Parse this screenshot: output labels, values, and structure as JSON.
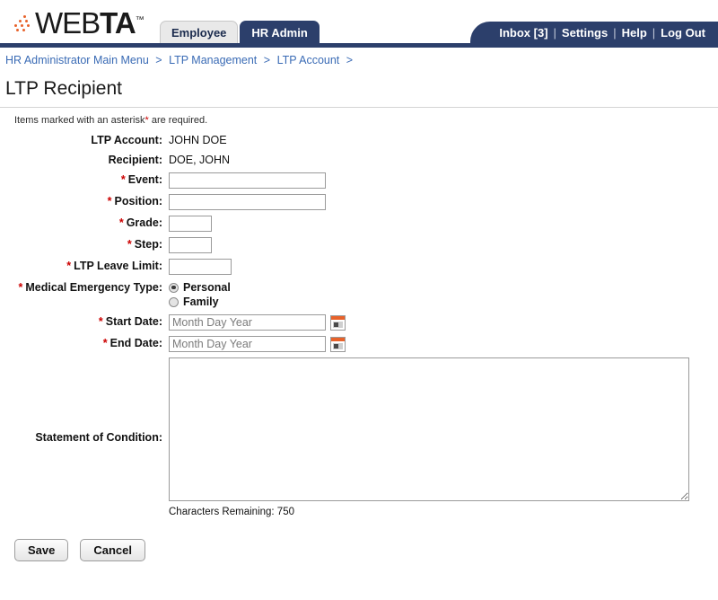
{
  "app": {
    "logo_text_light": "WEB",
    "logo_text_bold": "TA",
    "logo_tm": "™"
  },
  "tabs": [
    {
      "label": "Employee",
      "active": false
    },
    {
      "label": "HR Admin",
      "active": true
    }
  ],
  "navbar": {
    "items": [
      "Inbox [3]",
      "Settings",
      "Help",
      "Log Out"
    ],
    "separator": "|"
  },
  "breadcrumb": {
    "items": [
      "HR Administrator Main Menu",
      "LTP Management",
      "LTP Account"
    ],
    "separator": ">",
    "trailing": ">"
  },
  "page": {
    "title": "LTP Recipient",
    "required_note_before": "Items marked with an asterisk",
    "required_note_asterisk": "*",
    "required_note_after": " are required."
  },
  "form": {
    "asterisk": "*",
    "rows": [
      {
        "label": "LTP Account:",
        "required": false,
        "type": "static",
        "value": "JOHN DOE"
      },
      {
        "label": "Recipient:",
        "required": false,
        "type": "static",
        "value": "DOE, JOHN"
      },
      {
        "label": "Event:",
        "required": true,
        "type": "text",
        "value": "",
        "placeholder": ""
      },
      {
        "label": "Position:",
        "required": true,
        "type": "text",
        "value": "",
        "placeholder": ""
      },
      {
        "label": "Grade:",
        "required": true,
        "type": "text",
        "value": "",
        "placeholder": ""
      },
      {
        "label": "Step:",
        "required": true,
        "type": "text",
        "value": "",
        "placeholder": ""
      },
      {
        "label": "LTP Leave Limit:",
        "required": true,
        "type": "text",
        "value": "",
        "placeholder": ""
      },
      {
        "label": "Medical Emergency Type:",
        "required": true,
        "type": "radio"
      },
      {
        "label": "Start Date:",
        "required": true,
        "type": "date",
        "value": "",
        "placeholder": "Month Day Year"
      },
      {
        "label": "End Date:",
        "required": true,
        "type": "date",
        "value": "",
        "placeholder": "Month Day Year"
      },
      {
        "label": "Statement of Condition:",
        "required": false,
        "type": "textarea",
        "value": ""
      }
    ],
    "medical_emergency_type": {
      "options": [
        {
          "label": "Personal",
          "selected": true
        },
        {
          "label": "Family",
          "selected": false
        }
      ]
    },
    "statement": {
      "value": "",
      "chars_remaining_label": "Characters Remaining: 750"
    }
  },
  "buttons": {
    "save": "Save",
    "cancel": "Cancel"
  },
  "colors": {
    "navy": "#2c3f6b",
    "orange": "#e8622a",
    "link_blue": "#3a6bb5",
    "required_red": "#cc0000"
  }
}
